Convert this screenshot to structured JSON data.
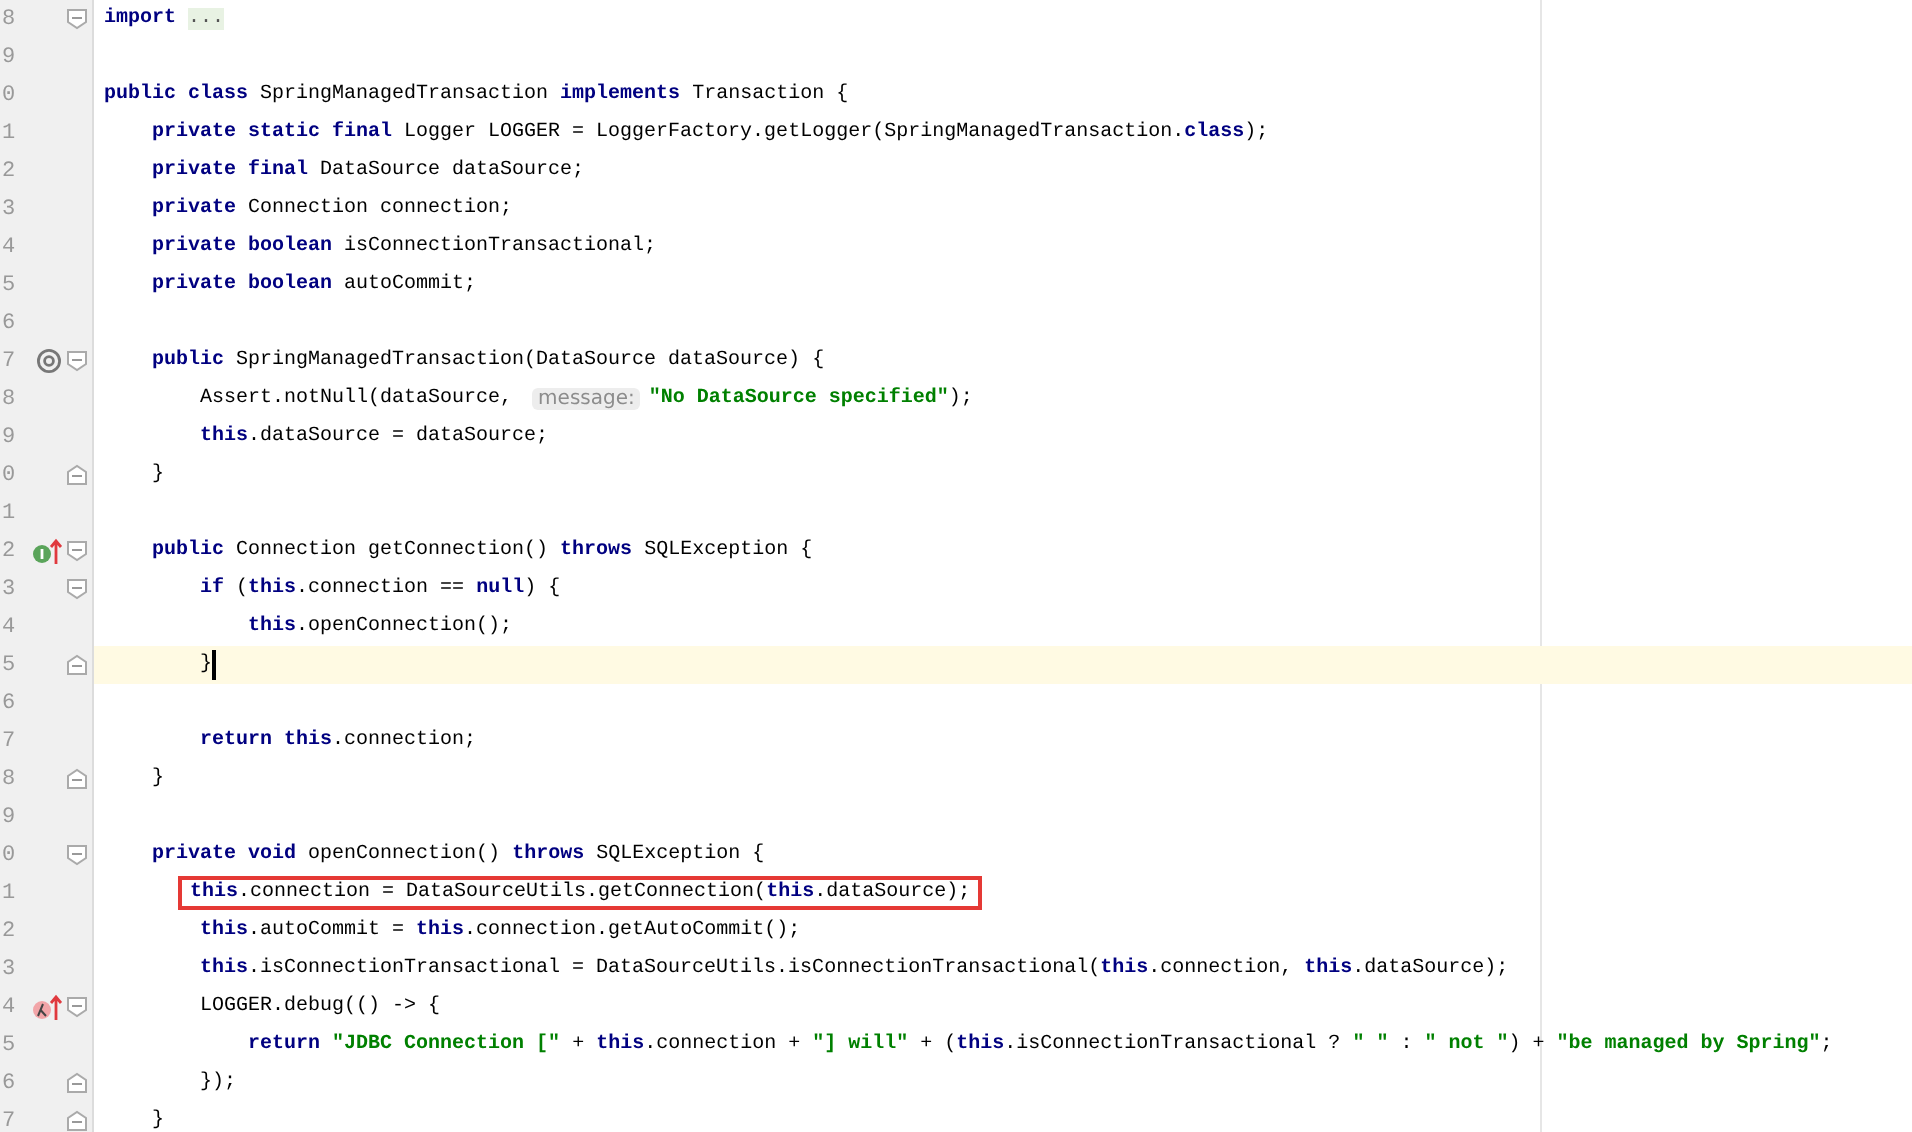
{
  "editor": {
    "lines": [
      {
        "number": "8",
        "fold": {
          "kind": "start"
        },
        "current": false,
        "boxed": false,
        "tokens": [
          {
            "kind": "keyword",
            "text": "import "
          },
          {
            "kind": "folded",
            "text": "..."
          }
        ]
      },
      {
        "number": "9",
        "current": false,
        "boxed": false
      },
      {
        "number": "0",
        "current": false,
        "boxed": false,
        "tokens": [
          {
            "kind": "keyword",
            "text": "public class "
          },
          {
            "kind": "plain",
            "text": "SpringManagedTransaction "
          },
          {
            "kind": "keyword",
            "text": "implements "
          },
          {
            "kind": "plain",
            "text": "Transaction {"
          }
        ]
      },
      {
        "number": "1",
        "current": false,
        "boxed": false,
        "tokens": [
          {
            "kind": "keyword",
            "text": "    private static final "
          },
          {
            "kind": "plain",
            "text": "Logger LOGGER = LoggerFactory.getLogger(SpringManagedTransaction."
          },
          {
            "kind": "keyword",
            "text": "class"
          },
          {
            "kind": "plain",
            "text": ");"
          }
        ]
      },
      {
        "number": "2",
        "current": false,
        "boxed": false,
        "tokens": [
          {
            "kind": "keyword",
            "text": "    private final "
          },
          {
            "kind": "plain",
            "text": "DataSource dataSource;"
          }
        ]
      },
      {
        "number": "3",
        "current": false,
        "boxed": false,
        "tokens": [
          {
            "kind": "keyword",
            "text": "    private "
          },
          {
            "kind": "plain",
            "text": "Connection connection;"
          }
        ]
      },
      {
        "number": "4",
        "current": false,
        "boxed": false,
        "tokens": [
          {
            "kind": "keyword",
            "text": "    private boolean "
          },
          {
            "kind": "plain",
            "text": "isConnectionTransactional;"
          }
        ]
      },
      {
        "number": "5",
        "current": false,
        "boxed": false,
        "tokens": [
          {
            "kind": "keyword",
            "text": "    private boolean "
          },
          {
            "kind": "plain",
            "text": "autoCommit;"
          }
        ]
      },
      {
        "number": "6",
        "current": false,
        "boxed": false
      },
      {
        "number": "7",
        "fold": {
          "kind": "start"
        },
        "marker": {
          "kind": "at"
        },
        "current": false,
        "boxed": false,
        "tokens": [
          {
            "kind": "keyword",
            "text": "    public "
          },
          {
            "kind": "plain",
            "text": "SpringManagedTransaction(DataSource dataSource) {"
          }
        ]
      },
      {
        "number": "8",
        "current": false,
        "boxed": false,
        "tokens": [
          {
            "kind": "plain",
            "text": "        Assert.notNull(dataSource, "
          },
          {
            "kind": "hint",
            "text": "message:"
          },
          {
            "kind": "string",
            "text": "\"No DataSource specified\""
          },
          {
            "kind": "plain",
            "text": ");"
          }
        ]
      },
      {
        "number": "9",
        "current": false,
        "boxed": false,
        "tokens": [
          {
            "kind": "keyword",
            "text": "        this"
          },
          {
            "kind": "plain",
            "text": ".dataSource = dataSource;"
          }
        ]
      },
      {
        "number": "0",
        "fold": {
          "kind": "end"
        },
        "current": false,
        "boxed": false,
        "tokens": [
          {
            "kind": "plain",
            "text": "    }"
          }
        ]
      },
      {
        "number": "1",
        "current": false,
        "boxed": false
      },
      {
        "number": "2",
        "fold": {
          "kind": "start"
        },
        "marker": {
          "kind": "implements"
        },
        "current": false,
        "boxed": false,
        "tokens": [
          {
            "kind": "keyword",
            "text": "    public "
          },
          {
            "kind": "plain",
            "text": "Connection getConnection() "
          },
          {
            "kind": "keyword",
            "text": "throws "
          },
          {
            "kind": "plain",
            "text": "SQLException {"
          }
        ]
      },
      {
        "number": "3",
        "fold": {
          "kind": "start"
        },
        "current": false,
        "boxed": false,
        "tokens": [
          {
            "kind": "keyword",
            "text": "        if "
          },
          {
            "kind": "plain",
            "text": "("
          },
          {
            "kind": "keyword",
            "text": "this"
          },
          {
            "kind": "plain",
            "text": ".connection == "
          },
          {
            "kind": "keyword",
            "text": "null"
          },
          {
            "kind": "plain",
            "text": ") {"
          }
        ]
      },
      {
        "number": "4",
        "current": false,
        "boxed": false,
        "tokens": [
          {
            "kind": "keyword",
            "text": "            this"
          },
          {
            "kind": "plain",
            "text": ".openConnection();"
          }
        ]
      },
      {
        "number": "5",
        "fold": {
          "kind": "end"
        },
        "current": true,
        "boxed": false,
        "tokens": [
          {
            "kind": "plain",
            "text": "        }"
          }
        ]
      },
      {
        "number": "6",
        "current": false,
        "boxed": false
      },
      {
        "number": "7",
        "current": false,
        "boxed": false,
        "tokens": [
          {
            "kind": "keyword",
            "text": "        return this"
          },
          {
            "kind": "plain",
            "text": ".connection;"
          }
        ]
      },
      {
        "number": "8",
        "fold": {
          "kind": "end"
        },
        "current": false,
        "boxed": false,
        "tokens": [
          {
            "kind": "plain",
            "text": "    }"
          }
        ]
      },
      {
        "number": "9",
        "current": false,
        "boxed": false
      },
      {
        "number": "0",
        "fold": {
          "kind": "start"
        },
        "current": false,
        "boxed": false,
        "tokens": [
          {
            "kind": "keyword",
            "text": "    private void "
          },
          {
            "kind": "plain",
            "text": "openConnection() "
          },
          {
            "kind": "keyword",
            "text": "throws "
          },
          {
            "kind": "plain",
            "text": "SQLException {"
          }
        ]
      },
      {
        "number": "1",
        "current": false,
        "boxed": true,
        "tokens": [
          {
            "kind": "keyword",
            "text": "this"
          },
          {
            "kind": "plain",
            "text": ".connection = DataSourceUtils.getConnection("
          },
          {
            "kind": "keyword",
            "text": "this"
          },
          {
            "kind": "plain",
            "text": ".dataSource);"
          }
        ]
      },
      {
        "number": "2",
        "current": false,
        "boxed": false,
        "tokens": [
          {
            "kind": "keyword",
            "text": "        this"
          },
          {
            "kind": "plain",
            "text": ".autoCommit = "
          },
          {
            "kind": "keyword",
            "text": "this"
          },
          {
            "kind": "plain",
            "text": ".connection.getAutoCommit();"
          }
        ]
      },
      {
        "number": "3",
        "current": false,
        "boxed": false,
        "tokens": [
          {
            "kind": "keyword",
            "text": "        this"
          },
          {
            "kind": "plain",
            "text": ".isConnectionTransactional = DataSourceUtils.isConnectionTransactional("
          },
          {
            "kind": "keyword",
            "text": "this"
          },
          {
            "kind": "plain",
            "text": ".connection, "
          },
          {
            "kind": "keyword",
            "text": "this"
          },
          {
            "kind": "plain",
            "text": ".dataSource);"
          }
        ]
      },
      {
        "number": "4",
        "fold": {
          "kind": "start"
        },
        "marker": {
          "kind": "lambda"
        },
        "current": false,
        "boxed": false,
        "tokens": [
          {
            "kind": "plain",
            "text": "        LOGGER.debug(() -> {"
          }
        ]
      },
      {
        "number": "5",
        "current": false,
        "boxed": false,
        "tokens": [
          {
            "kind": "keyword",
            "text": "            return "
          },
          {
            "kind": "string",
            "text": "\"JDBC Connection [\""
          },
          {
            "kind": "plain",
            "text": " + "
          },
          {
            "kind": "keyword",
            "text": "this"
          },
          {
            "kind": "plain",
            "text": ".connection + "
          },
          {
            "kind": "string",
            "text": "\"] will\""
          },
          {
            "kind": "plain",
            "text": " + ("
          },
          {
            "kind": "keyword",
            "text": "this"
          },
          {
            "kind": "plain",
            "text": ".isConnectionTransactional ? "
          },
          {
            "kind": "string",
            "text": "\" \""
          },
          {
            "kind": "plain",
            "text": " : "
          },
          {
            "kind": "string",
            "text": "\" not \""
          },
          {
            "kind": "plain",
            "text": ") + "
          },
          {
            "kind": "string",
            "text": "\"be managed by Spring\""
          },
          {
            "kind": "plain",
            "text": ";"
          }
        ]
      },
      {
        "number": "6",
        "fold": {
          "kind": "end"
        },
        "current": false,
        "boxed": false,
        "tokens": [
          {
            "kind": "plain",
            "text": "        });"
          }
        ]
      },
      {
        "number": "7",
        "fold": {
          "kind": "end"
        },
        "current": false,
        "boxed": false,
        "tokens": [
          {
            "kind": "plain",
            "text": "    }"
          }
        ]
      }
    ]
  }
}
